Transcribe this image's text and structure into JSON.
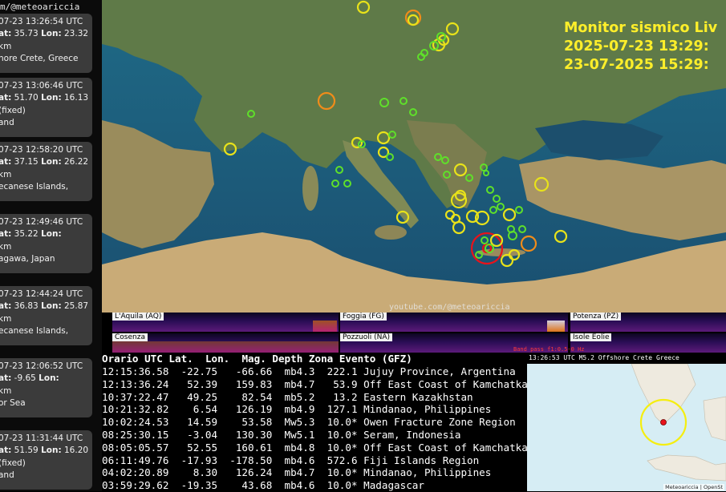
{
  "sidebar": {
    "header": "m/@meteoariccia",
    "cards": [
      {
        "time": "07-23 13:26:54 UTC",
        "lat_label": "at:",
        "lat": "35.73",
        "lon_label": "Lon:",
        "lon": "23.32",
        "depth": "km",
        "place": "hore Crete, Greece"
      },
      {
        "time": "07-23 13:06:46 UTC",
        "lat_label": "at:",
        "lat": "51.70",
        "lon_label": "Lon:",
        "lon": "16.13",
        "depth": "(fixed)",
        "place": "and"
      },
      {
        "time": "07-23 12:58:20 UTC",
        "lat_label": "at:",
        "lat": "37.15",
        "lon_label": "Lon:",
        "lon": "26.22",
        "depth": "km",
        "place": "ecanese Islands,"
      },
      {
        "time": "07-23 12:49:46 UTC",
        "lat_label": "at:",
        "lat": "35.22",
        "lon_label": "Lon:",
        "lon": "",
        "depth": "km",
        "place": "agawa, Japan"
      },
      {
        "time": "07-23 12:44:24 UTC",
        "lat_label": "at:",
        "lat": "36.83",
        "lon_label": "Lon:",
        "lon": "25.87",
        "depth": "km",
        "place": "ecanese Islands,"
      },
      {
        "time": "07-23 12:06:52 UTC",
        "lat_label": "at:",
        "lat": "-9.65",
        "lon_label": "Lon:",
        "lon": "",
        "depth": "km",
        "place": "or Sea"
      },
      {
        "time": "07-23 11:31:44 UTC",
        "lat_label": "at:",
        "lat": "51.59",
        "lon_label": "Lon:",
        "lon": "16.20",
        "depth": "(fixed)",
        "place": "and"
      }
    ]
  },
  "monitor": {
    "title": "Monitor sismico Liv",
    "utc_line": "2025-07-23  13:29:",
    "local_line": "23-07-2025  15:29:"
  },
  "watermark": "youtube.com/@meteoariccia",
  "helicorders": {
    "labels": [
      "L'Aquila (AQ)",
      "Foggia (FG)",
      "Potenza (PZ)",
      "Cosenza",
      "Pozzuoli (NA)",
      "Isole Eolie"
    ],
    "bandpass": "Band pass f1:0.5-0 Hz"
  },
  "table": {
    "headers": {
      "time": "Orario UTC",
      "lat": "Lat.",
      "lon": "Lon.",
      "mag": "Mag.",
      "depth": "Depth",
      "zone": "Zona Evento (GFZ)"
    },
    "rows": [
      {
        "time": "12:15:36.58",
        "lat": "-22.75",
        "lon": "-66.66",
        "mag": "mb4.3",
        "depth": "222.1",
        "zone": "Jujuy Province, Argentina"
      },
      {
        "time": "12:13:36.24",
        "lat": "52.39",
        "lon": "159.83",
        "mag": "mb4.7",
        "depth": "53.9",
        "zone": "Off East Coast of Kamchatka"
      },
      {
        "time": "10:37:22.47",
        "lat": "49.25",
        "lon": "82.54",
        "mag": "mb5.2",
        "depth": "13.2",
        "zone": "Eastern Kazakhstan"
      },
      {
        "time": "10:21:32.82",
        "lat": "6.54",
        "lon": "126.19",
        "mag": "mb4.9",
        "depth": "127.1",
        "zone": "Mindanao, Philippines"
      },
      {
        "time": "10:02:24.53",
        "lat": "14.59",
        "lon": "53.58",
        "mag": "Mw5.3",
        "depth": "10.0*",
        "zone": "Owen Fracture Zone Region"
      },
      {
        "time": "08:25:30.15",
        "lat": "-3.04",
        "lon": "130.30",
        "mag": "Mw5.1",
        "depth": "10.0*",
        "zone": "Seram, Indonesia"
      },
      {
        "time": "08:05:05.57",
        "lat": "52.55",
        "lon": "160.61",
        "mag": "mb4.8",
        "depth": "10.0*",
        "zone": "Off East Coast of Kamchatka"
      },
      {
        "time": "06:11:49.76",
        "lat": "-17.93",
        "lon": "-178.50",
        "mag": "mb4.6",
        "depth": "572.6",
        "zone": "Fiji Islands Region"
      },
      {
        "time": "04:02:20.89",
        "lat": "8.30",
        "lon": "126.24",
        "mag": "mb4.7",
        "depth": "10.0*",
        "zone": "Mindanao, Philippines"
      },
      {
        "time": "03:59:29.62",
        "lat": "-19.35",
        "lon": "43.68",
        "mag": "mb4.6",
        "depth": "10.0*",
        "zone": "Madagascar"
      }
    ]
  },
  "minimap": {
    "caption": "13:26:53 UTC M5.2 Offshore Crete Greece",
    "attribution": "Meteoariccia | OpenSt"
  },
  "colors": {
    "title": "#ffef2a",
    "marker_strong": "#e8131b",
    "marker_mid": "#f08c1a",
    "marker_yellow": "#e8e21a",
    "marker_green": "#5fe02a"
  }
}
